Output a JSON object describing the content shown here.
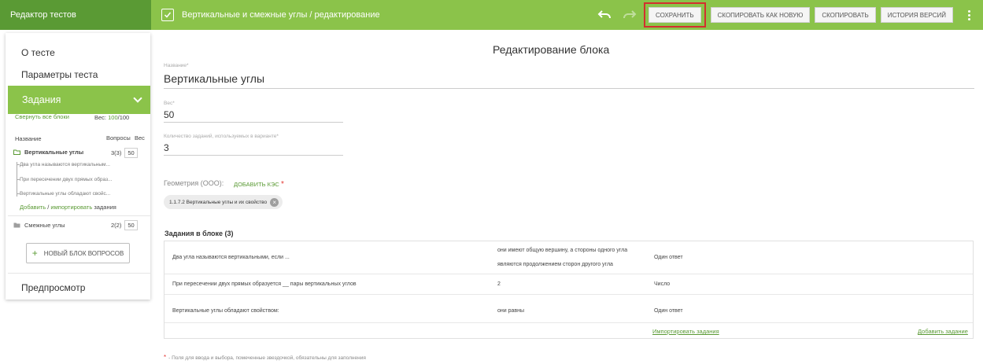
{
  "app": {
    "title": "Редактор тестов"
  },
  "toolbar": {
    "document_title": "Вертикальные и смежные углы / редактирование",
    "buttons": {
      "save": "СОХРАНИТЬ",
      "copy_as_new": "СКОПИРОВАТЬ КАК НОВУЮ",
      "copy": "СКОПИРОВАТЬ",
      "version_history": "ИСТОРИЯ ВЕРСИЙ"
    }
  },
  "sidebar": {
    "about": "О тесте",
    "params": "Параметры теста",
    "tasks": "Задания",
    "collapse_all": "Свернуть все блоки",
    "weight_label": "Вес:",
    "weight_value": "100",
    "weight_total": "/100",
    "col_name": "Название",
    "col_questions": "Вопросы",
    "col_weight": "Вес",
    "blocks": [
      {
        "name": "Вертикальные углы",
        "count": "3(3)",
        "weight": "50",
        "items": [
          "Два угла называются вертикальным...",
          "При пересечении двух прямых образ...",
          "Вертикальные углы обладают свойс..."
        ],
        "add_link_1": "Добавить",
        "add_sep": " / ",
        "add_link_2": "импортировать",
        "add_suffix": " задания"
      },
      {
        "name": "Смежные углы",
        "count": "2(2)",
        "weight": "50"
      }
    ],
    "new_block": "НОВЫЙ БЛОК ВОПРОСОВ",
    "preview": "Предпросмотр"
  },
  "main": {
    "title": "Редактирование блока",
    "name_label": "Название*",
    "name_value": "Вертикальные углы",
    "weight_label": "Вес*",
    "weight_value": "50",
    "count_label": "Количество заданий, используемых в варианте*",
    "count_value": "3",
    "geometry_label": "Геометрия (ООО):",
    "add_kes": "ДОБАВИТЬ КЭС",
    "kes_chip": "1.1.7.2 Вертикальные углы и их свойство",
    "tasks_title": "Задания в блоке (3)",
    "tasks": [
      {
        "question": "Два угла называются вертикальными, если ...",
        "answer_line1": "они имеют общую вершину, а стороны одного угла",
        "answer_line2": "являются продолжением сторон другого угла",
        "type": "Один ответ"
      },
      {
        "question": "При пересечении двух прямых образуется __ пары вертикальных углов",
        "answer": "2",
        "type": "Число"
      },
      {
        "question": "Вертикальные углы обладают свойством:",
        "answer": "они равны",
        "type": "Один ответ"
      }
    ],
    "import_tasks": "Импортировать задания",
    "add_task": "Добавить задание",
    "required_note": "- Поля для ввода и выбора, помеченные звездочкой, обязательны для заполнения"
  },
  "colors": {
    "accent": "#8bc34a",
    "accent_dark": "#5a9a34",
    "highlight": "#d32f2f"
  },
  "icons": [
    "document-edit-icon",
    "undo-icon",
    "redo-icon",
    "more-vert-icon",
    "chevron-down-icon",
    "folder-open-icon",
    "folder-icon",
    "plus-icon",
    "chip-remove-icon"
  ]
}
